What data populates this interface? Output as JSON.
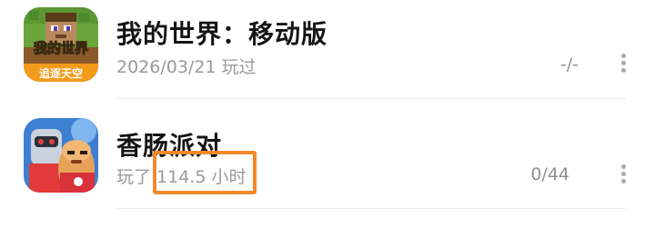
{
  "games": [
    {
      "title": "我的世界：移动版",
      "subtitle": "2026/03/21 玩过",
      "progress": "-/-",
      "icon_text": "我的世界",
      "icon_banner": "追逐天空"
    },
    {
      "title": "香肠派对",
      "subtitle_prefix": "玩了 ",
      "subtitle_value": "114.5 小时",
      "progress": "0/44"
    }
  ],
  "highlight_color": "#f4892c"
}
